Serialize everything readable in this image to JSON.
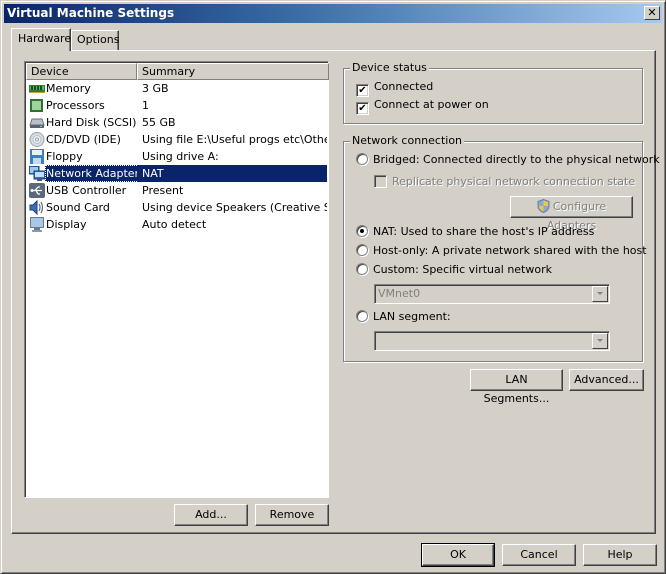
{
  "window": {
    "title": "Virtual Machine Settings",
    "close_label": "✕"
  },
  "tabs": [
    {
      "label": "Hardware",
      "active": true
    },
    {
      "label": "Options",
      "active": false
    }
  ],
  "device_list": {
    "columns": [
      "Device",
      "Summary"
    ],
    "rows": [
      {
        "icon": "memory-icon",
        "name": "Memory",
        "summary": "3 GB"
      },
      {
        "icon": "processor-icon",
        "name": "Processors",
        "summary": "1"
      },
      {
        "icon": "hard-disk-icon",
        "name": "Hard Disk (SCSI)",
        "summary": "55 GB"
      },
      {
        "icon": "cd-dvd-icon",
        "name": "CD/DVD (IDE)",
        "summary": "Using file E:\\Useful progs etc\\Othe..."
      },
      {
        "icon": "floppy-icon",
        "name": "Floppy",
        "summary": "Using drive A:"
      },
      {
        "icon": "network-adapter-icon",
        "name": "Network Adapter",
        "summary": "NAT",
        "selected": true
      },
      {
        "icon": "usb-icon",
        "name": "USB Controller",
        "summary": "Present"
      },
      {
        "icon": "sound-card-icon",
        "name": "Sound Card",
        "summary": "Using device Speakers (Creative S..."
      },
      {
        "icon": "display-icon",
        "name": "Display",
        "summary": "Auto detect"
      }
    ],
    "add_label": "Add...",
    "remove_label": "Remove"
  },
  "device_status": {
    "title": "Device status",
    "connected": {
      "label": "Connected",
      "checked": true
    },
    "connect_at_power_on": {
      "label": "Connect at power on",
      "checked": true
    }
  },
  "network_connection": {
    "title": "Network connection",
    "bridged": {
      "label": "Bridged: Connected directly to the physical network",
      "selected": false
    },
    "replicate": {
      "label": "Replicate physical network connection state",
      "checked": false,
      "disabled": true
    },
    "configure_adapters_label": "Configure Adapters",
    "nat": {
      "label": "NAT: Used to share the host's IP address",
      "selected": true
    },
    "host_only": {
      "label": "Host-only: A private network shared with the host",
      "selected": false
    },
    "custom": {
      "label": "Custom: Specific virtual network",
      "selected": false
    },
    "custom_network_value": "VMnet0",
    "lan_segment": {
      "label": "LAN segment:",
      "selected": false
    },
    "lan_segment_value": "",
    "lan_segments_button": "LAN Segments...",
    "advanced_button": "Advanced..."
  },
  "footer": {
    "ok_label": "OK",
    "cancel_label": "Cancel",
    "help_label": "Help"
  },
  "colors": {
    "selection": "#0a246a",
    "face": "#d4d0c8",
    "title_start": "#0a246a",
    "title_end": "#a6caf0"
  }
}
